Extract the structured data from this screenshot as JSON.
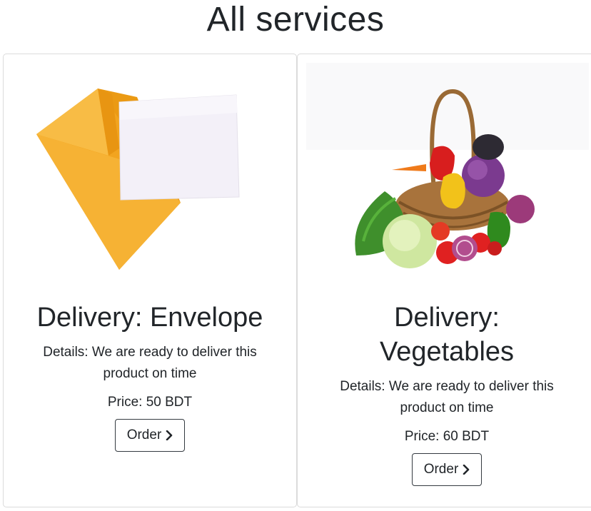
{
  "page": {
    "title": "All services"
  },
  "services": [
    {
      "title": "Delivery: Envelope",
      "details": "Details: We are ready to deliver this product on time",
      "price": "Price: 50 BDT",
      "button_label": "Order",
      "image": "envelope-image"
    },
    {
      "title": "Delivery: Vegetables",
      "details": "Details: We are ready to deliver this product on time",
      "price": "Price: 60 BDT",
      "button_label": "Order",
      "image": "vegetable-basket-image"
    }
  ],
  "icons": {
    "order_button_icon": "chevron-right-icon"
  },
  "colors": {
    "text": "#212529",
    "border": "#343a40",
    "envelope": "#f5a623"
  }
}
